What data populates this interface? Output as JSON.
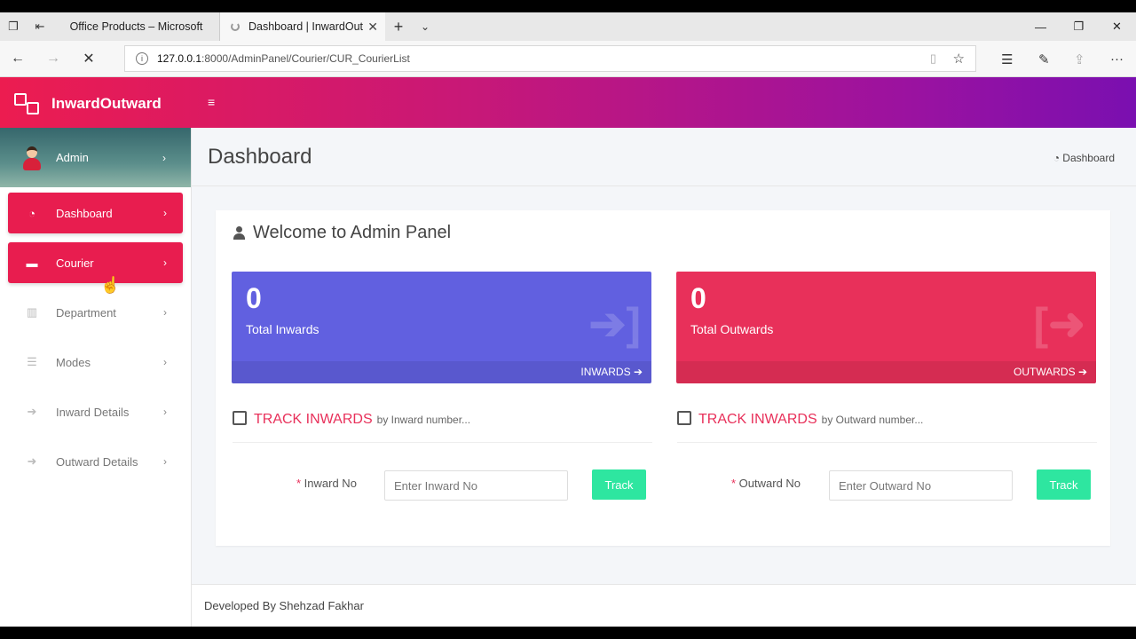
{
  "browser": {
    "tabs": [
      {
        "label": "Office Products – Microsoft"
      },
      {
        "label": "Dashboard | InwardOut"
      }
    ],
    "url_host": "127.0.0.1",
    "url_rest": ":8000/AdminPanel/Courier/CUR_CourierList"
  },
  "app": {
    "brand": "InwardOutward"
  },
  "sidebar": {
    "user": "Admin",
    "items": [
      {
        "label": "Dashboard"
      },
      {
        "label": "Courier"
      },
      {
        "label": "Department"
      },
      {
        "label": "Modes"
      },
      {
        "label": "Inward Details"
      },
      {
        "label": "Outward Details"
      }
    ]
  },
  "content": {
    "title": "Dashboard",
    "breadcrumb": "Dashboard",
    "welcome": "Welcome to Admin Panel",
    "cards": [
      {
        "value": "0",
        "label": "Total Inwards",
        "link": "INWARDS",
        "color": "#6160e0"
      },
      {
        "value": "0",
        "label": "Total Outwards",
        "link": "OUTWARDS",
        "color": "#e8305a"
      }
    ],
    "track": [
      {
        "title": "TRACK INWARDS",
        "sub": "by Inward number...",
        "field_label": "Inward No",
        "placeholder": "Enter Inward No",
        "button": "Track"
      },
      {
        "title": "TRACK INWARDS",
        "sub": "by Outward number...",
        "field_label": "Outward No",
        "placeholder": "Enter Outward No",
        "button": "Track"
      }
    ],
    "footer": "Developed By Shehzad Fakhar"
  },
  "colors": {
    "accent": "#e81d4f",
    "track_button": "#2ee6a0",
    "header_start": "#ec1c50",
    "header_end": "#7a0fb0"
  }
}
